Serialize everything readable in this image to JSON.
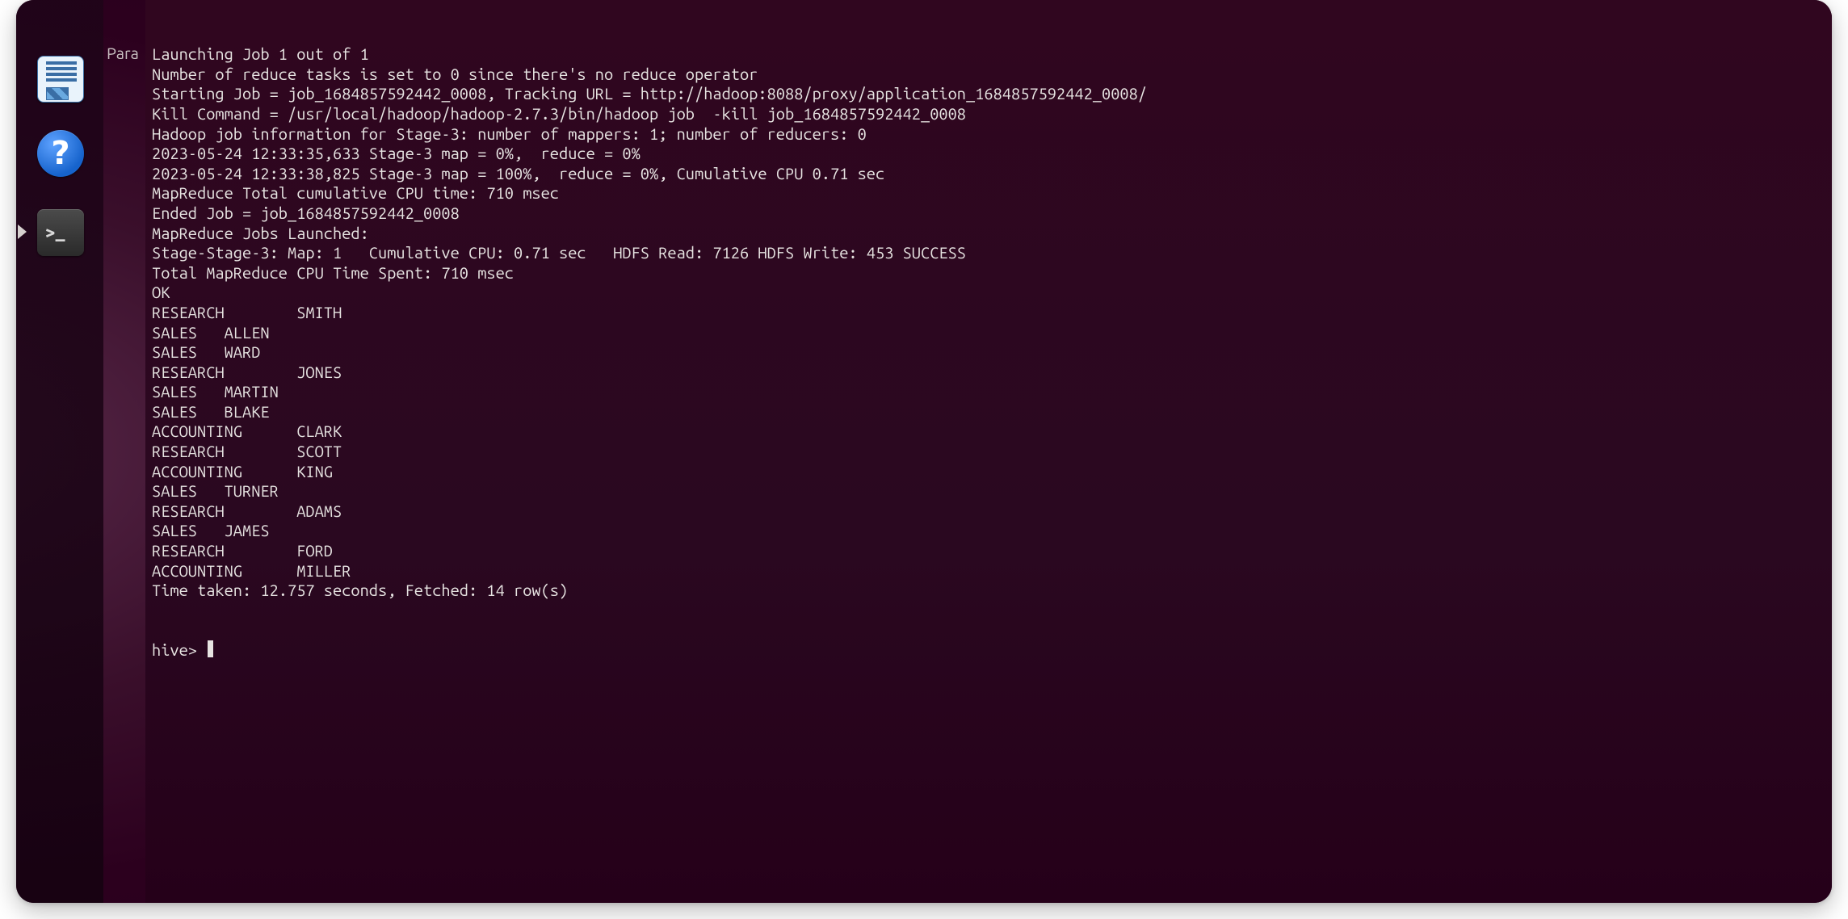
{
  "launcher": {
    "items": [
      {
        "name": "libreoffice-writer",
        "tooltip": "LibreOffice Writer"
      },
      {
        "name": "help",
        "tooltip": "Help",
        "glyph": "?"
      },
      {
        "name": "terminal",
        "tooltip": "Terminal",
        "glyph": ">_"
      }
    ]
  },
  "desktop_snippet": {
    "label": "Para"
  },
  "terminal": {
    "edge_char": "|",
    "log": [
      "Launching Job 1 out of 1",
      "Number of reduce tasks is set to 0 since there's no reduce operator",
      "Starting Job = job_1684857592442_0008, Tracking URL = http://hadoop:8088/proxy/application_1684857592442_0008/",
      "Kill Command = /usr/local/hadoop/hadoop-2.7.3/bin/hadoop job  -kill job_1684857592442_0008",
      "Hadoop job information for Stage-3: number of mappers: 1; number of reducers: 0",
      "2023-05-24 12:33:35,633 Stage-3 map = 0%,  reduce = 0%",
      "2023-05-24 12:33:38,825 Stage-3 map = 100%,  reduce = 0%, Cumulative CPU 0.71 sec",
      "MapReduce Total cumulative CPU time: 710 msec",
      "Ended Job = job_1684857592442_0008",
      "MapReduce Jobs Launched:",
      "Stage-Stage-3: Map: 1   Cumulative CPU: 0.71 sec   HDFS Read: 7126 HDFS Write: 453 SUCCESS",
      "Total MapReduce CPU Time Spent: 710 msec",
      "OK"
    ],
    "rows": [
      {
        "dept": "RESEARCH",
        "name": "SMITH"
      },
      {
        "dept": "SALES",
        "name": "ALLEN",
        "compact": true
      },
      {
        "dept": "SALES",
        "name": "WARD",
        "compact": true
      },
      {
        "dept": "RESEARCH",
        "name": "JONES"
      },
      {
        "dept": "SALES",
        "name": "MARTIN",
        "compact": true
      },
      {
        "dept": "SALES",
        "name": "BLAKE",
        "compact": true
      },
      {
        "dept": "ACCOUNTING",
        "name": "CLARK"
      },
      {
        "dept": "RESEARCH",
        "name": "SCOTT"
      },
      {
        "dept": "ACCOUNTING",
        "name": "KING"
      },
      {
        "dept": "SALES",
        "name": "TURNER",
        "compact": true
      },
      {
        "dept": "RESEARCH",
        "name": "ADAMS"
      },
      {
        "dept": "SALES",
        "name": "JAMES",
        "compact": true
      },
      {
        "dept": "RESEARCH",
        "name": "FORD"
      },
      {
        "dept": "ACCOUNTING",
        "name": "MILLER"
      }
    ],
    "footer": "Time taken: 12.757 seconds, Fetched: 14 row(s)",
    "prompt": "hive> "
  }
}
